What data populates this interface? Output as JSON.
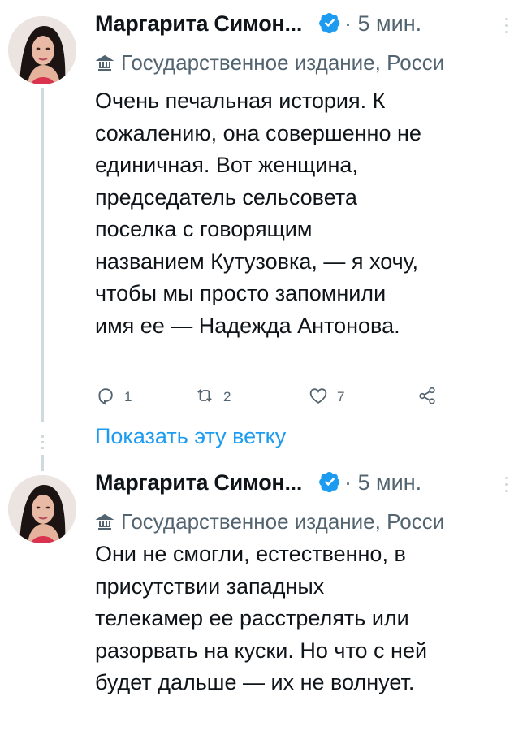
{
  "tweets": [
    {
      "author": "Маргарита Симон...",
      "time": "· 5 мин.",
      "label": "Государственное издание, Росси",
      "body": [
        "Очень печальная история. К",
        "сожалению, она совершенно не",
        "единичная. Вот женщина,",
        "председатель сельсовета",
        "поселка с говорящим",
        "названием Кутузовка, — я хочу,",
        "чтобы мы просто запомнили",
        "имя ее — Надежда Антонова."
      ],
      "actions": {
        "reply_count": "1",
        "retweet_count": "2",
        "like_count": "7"
      }
    },
    {
      "author": "Маргарита Симон...",
      "time": "· 5 мин.",
      "label": "Государственное издание, Росси",
      "body": [
        "Они не смогли, естественно, в",
        "присутствии западных",
        "телекамер ее расстрелять или",
        "разорвать на куски. Но что с ней",
        "будет дальше — их не волнует."
      ]
    }
  ],
  "show_thread": "Показать эту ветку",
  "icons": {
    "verified": "verified-badge-icon",
    "label": "state-media-flag-icon",
    "reply": "reply-icon",
    "retweet": "retweet-icon",
    "like": "like-icon",
    "share": "share-icon",
    "more": "more-icon"
  },
  "colors": {
    "accent": "#1d9bf0",
    "secondary_text": "#536471",
    "thread_line": "#cfd9de"
  }
}
